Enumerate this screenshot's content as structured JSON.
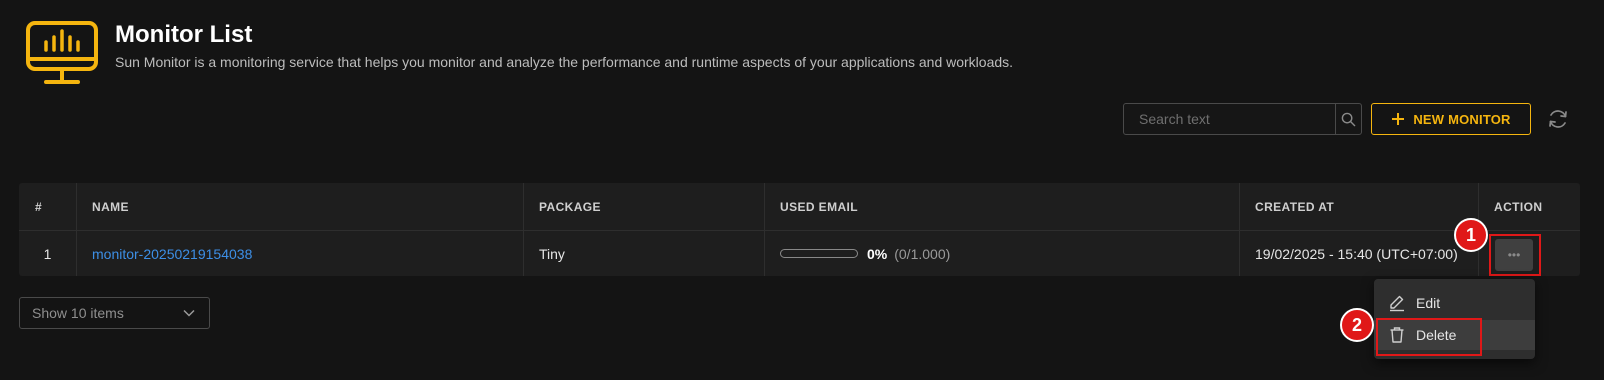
{
  "header": {
    "title": "Monitor List",
    "subtitle": "Sun Monitor is a monitoring service that helps you monitor and analyze the performance and runtime aspects of your applications and workloads."
  },
  "toolbar": {
    "search_placeholder": "Search text",
    "new_monitor_label": "NEW MONITOR"
  },
  "table": {
    "columns": [
      "#",
      "NAME",
      "PACKAGE",
      "USED EMAIL",
      "CREATED AT",
      "ACTION"
    ],
    "rows": [
      {
        "index": "1",
        "name": "monitor-20250219154038",
        "package": "Tiny",
        "used_email_percent": "0%",
        "used_email_count": "(0/1.000)",
        "used_email_fraction": 0,
        "created_at": "19/02/2025 - 15:40 (UTC+07:00)"
      }
    ]
  },
  "pagination": {
    "page_size_label": "Show 10 items"
  },
  "action_menu": {
    "items": [
      "Edit",
      "Delete"
    ]
  },
  "annotations": {
    "marker_1": "1",
    "marker_2": "2"
  },
  "colors": {
    "accent": "#f5b50f",
    "link": "#3d8fe6",
    "highlight": "#e01818",
    "background": "#141414"
  },
  "icons": [
    "monitor-icon",
    "search-icon",
    "plus-icon",
    "refresh-icon",
    "ellipsis-icon",
    "chevron-down-icon",
    "edit-icon",
    "trash-icon"
  ]
}
